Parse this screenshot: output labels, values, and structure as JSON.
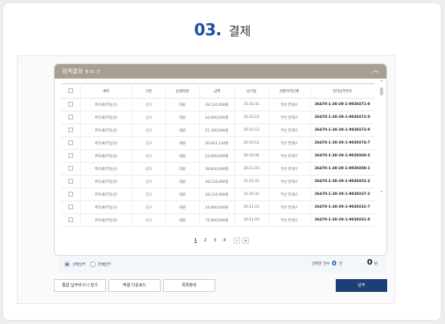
{
  "heading": {
    "step_number": "03.",
    "step_title": "결제"
  },
  "result": {
    "title": "검색결과",
    "count": "총 61 건",
    "columns": [
      "",
      "세목",
      "구분",
      "납세자명",
      "금액",
      "납기일",
      "관할자치단체",
      "전자납부번호"
    ],
    "rows": [
      {
        "tax": "취득세(부동산)",
        "type": "신고",
        "payer": "대원",
        "amount": "28,124,000원",
        "due": "21.03.31",
        "org": "부산 연제구",
        "epay": "26470-1-30-29-1-9030371-0"
      },
      {
        "tax": "취득세(부동산)",
        "type": "신고",
        "payer": "대원",
        "amount": "24,600,000원",
        "due": "20.10.12",
        "org": "부산 연제구",
        "epay": "26470-1-30-29-1-9030372-0"
      },
      {
        "tax": "취득세(부동산)",
        "type": "신고",
        "payer": "대원",
        "amount": "21,300,000원",
        "due": "20.10.12",
        "org": "부산 연제구",
        "epay": "26470-1-30-29-1-9030373-0"
      },
      {
        "tax": "취득세(부동산)",
        "type": "신고",
        "payer": "대원",
        "amount": "30,621,120원",
        "due": "20.10.12",
        "org": "부산 연제구",
        "epay": "26470-1-30-29-1-9030374-7"
      },
      {
        "tax": "취득세(부동산)",
        "type": "신고",
        "payer": "대원",
        "amount": "23,600,000원",
        "due": "20.10.06",
        "org": "부산 연제구",
        "epay": "26470-1-30-29-1-9030360-3"
      },
      {
        "tax": "취득세(부동산)",
        "type": "신고",
        "payer": "대원",
        "amount": "38,600,000원",
        "due": "20.11.03",
        "org": "부산 연제구",
        "epay": "26470-1-30-29-1-9030358-1"
      },
      {
        "tax": "취득세(부동산)",
        "type": "신고",
        "payer": "대원",
        "amount": "28,124,000원",
        "due": "21.03.31",
        "org": "부산 연제구",
        "epay": "26470-1-30-29-1-9030353-2"
      },
      {
        "tax": "취득세(부동산)",
        "type": "신고",
        "payer": "대원",
        "amount": "28,124,000원",
        "due": "21.03.31",
        "org": "부산 연제구",
        "epay": "26470-1-30-29-1-9030337-2"
      },
      {
        "tax": "취득세(부동산)",
        "type": "신고",
        "payer": "대원",
        "amount": "24,600,000원",
        "due": "20.11.03",
        "org": "부산 연제구",
        "epay": "26470-1-30-29-1-9030332-7"
      },
      {
        "tax": "취득세(부동산)",
        "type": "신고",
        "payer": "대원",
        "amount": "72,000,000원",
        "due": "20.11.03",
        "org": "부산 연제구",
        "epay": "26470-1-30-29-1-9030331-0"
      }
    ]
  },
  "pagination": {
    "pages": [
      "1",
      "2",
      "3",
      "4"
    ],
    "current": "1",
    "next": "›",
    "last": "»"
  },
  "summary": {
    "radio_selected": "선택납부",
    "radio_all": "전체납부",
    "count_label": "선택한 건수",
    "count_value": "0",
    "count_unit": "건",
    "amount_value": "0",
    "amount_unit": "원"
  },
  "buttons": {
    "cart": "통합 납부바구니 담기",
    "excel": "엑셀 다운로드",
    "print": "목록출력",
    "pay": "납부"
  },
  "colors": {
    "accent": "#1b4fa3",
    "header_bar": "#a89f91",
    "pay_button": "#1e3f74"
  },
  "icons": {
    "collapse": "chevron-up-icon",
    "scroll_up": "chevron-up-icon",
    "scroll_down": "chevron-down-icon"
  }
}
